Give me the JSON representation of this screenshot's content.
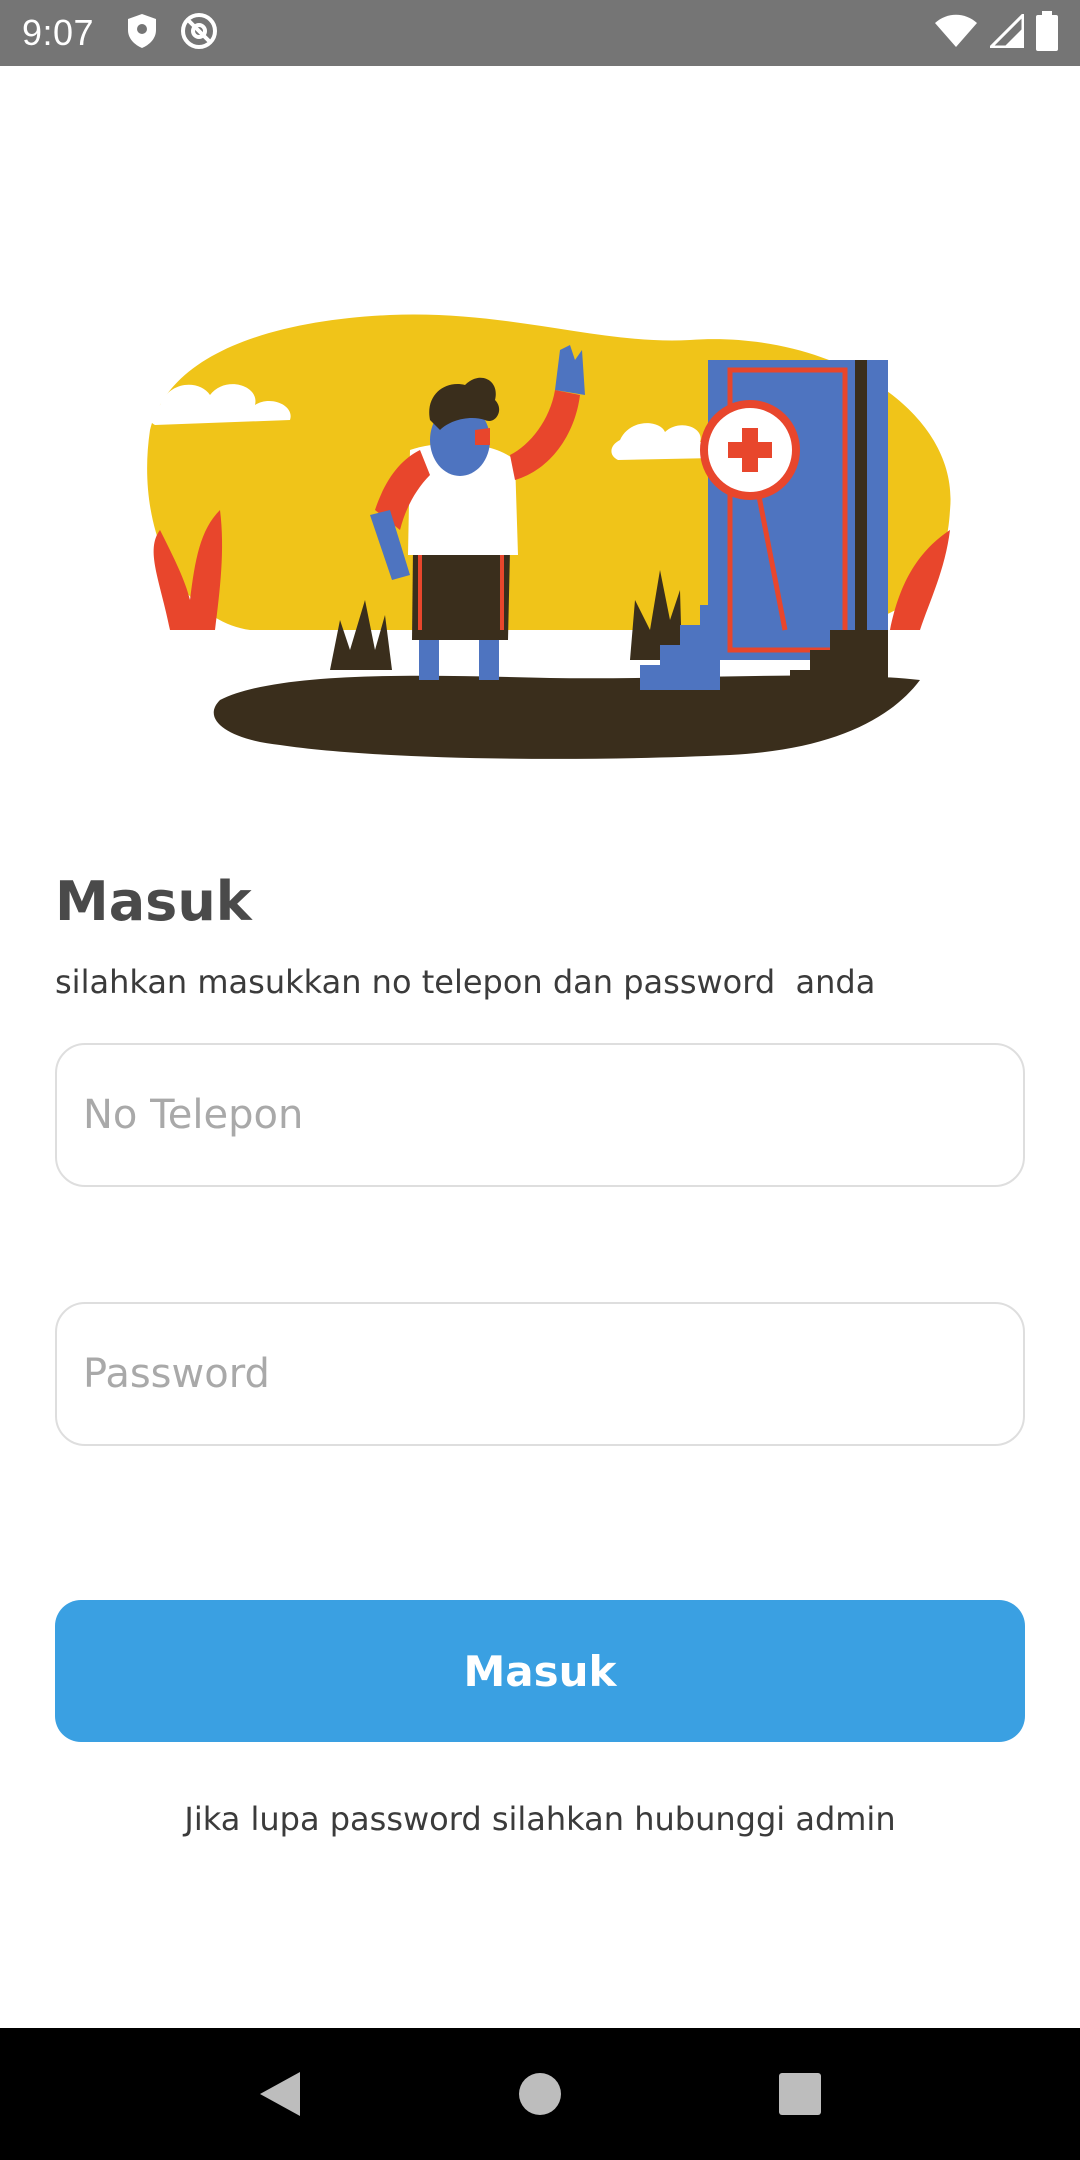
{
  "status_bar": {
    "time": "9:07",
    "icons": [
      "shield-icon",
      "at-sign-icon",
      "wifi-icon",
      "signal-icon",
      "battery-icon"
    ]
  },
  "illustration": {
    "description_icon": "person-waving-at-closed-door-illustration",
    "colors": {
      "sky": "#F0C419",
      "ground": "#3A2E1C",
      "door": "#4E74C0",
      "accent_red": "#E8462C"
    }
  },
  "login": {
    "title": "Masuk",
    "subtitle": "silahkan masukkan no telepon dan password  anda",
    "phone_placeholder": "No Telepon",
    "phone_value": "",
    "password_placeholder": "Password",
    "password_value": "",
    "button_label": "Masuk",
    "footer_note": "Jika lupa password silahkan hubunggi admin"
  },
  "colors": {
    "primary": "#3AA0E2",
    "title_text": "#4A4A4A"
  },
  "nav_bar": {
    "icons": [
      "back-icon",
      "home-icon",
      "recents-icon"
    ]
  }
}
